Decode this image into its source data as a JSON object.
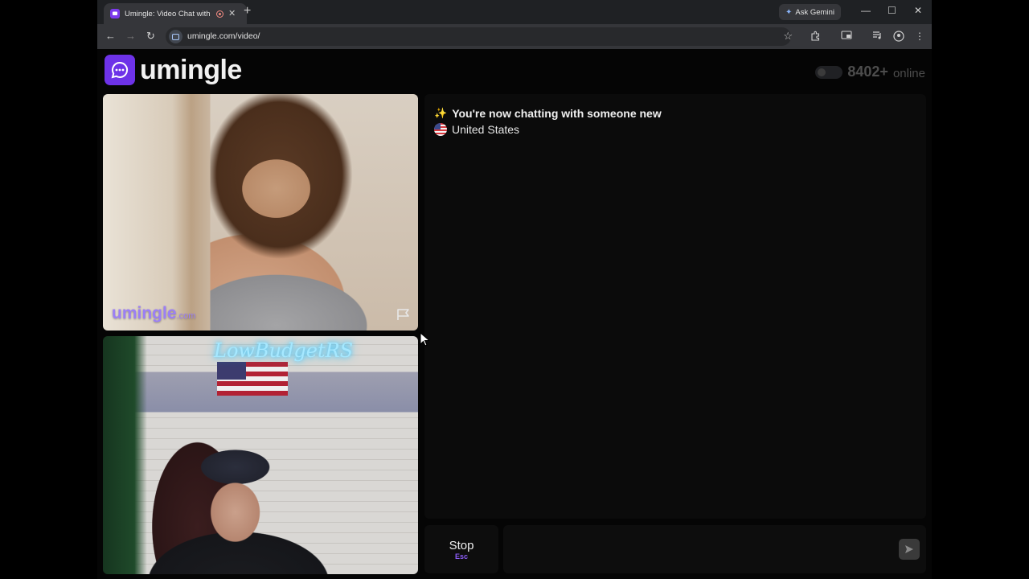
{
  "browser": {
    "tab_title": "Umingle: Video Chat with S",
    "tab_close": "✕",
    "new_tab": "+",
    "ask_gemini": "Ask Gemini",
    "url": "umingle.com/video/",
    "window_controls": {
      "minimize": "—",
      "maximize": "☐",
      "close": "✕"
    },
    "nav": {
      "back": "←",
      "forward": "→",
      "reload": "↻",
      "star": "☆",
      "menu": "⋮"
    }
  },
  "site": {
    "logo_text": "umingle",
    "online_count": "8402+",
    "online_label": "online"
  },
  "video": {
    "watermark": "umingle",
    "watermark_suffix": ".com",
    "neon_sign": "LowBudgetRS"
  },
  "chat": {
    "status_message": "You're now chatting with someone new",
    "country": "United States"
  },
  "controls": {
    "stop_label": "Stop",
    "stop_shortcut": "Esc",
    "message_placeholder": ""
  },
  "colors": {
    "brand": "#6d32e8",
    "watermark": "#9b7ff5",
    "shortcut": "#8b5cf6"
  }
}
